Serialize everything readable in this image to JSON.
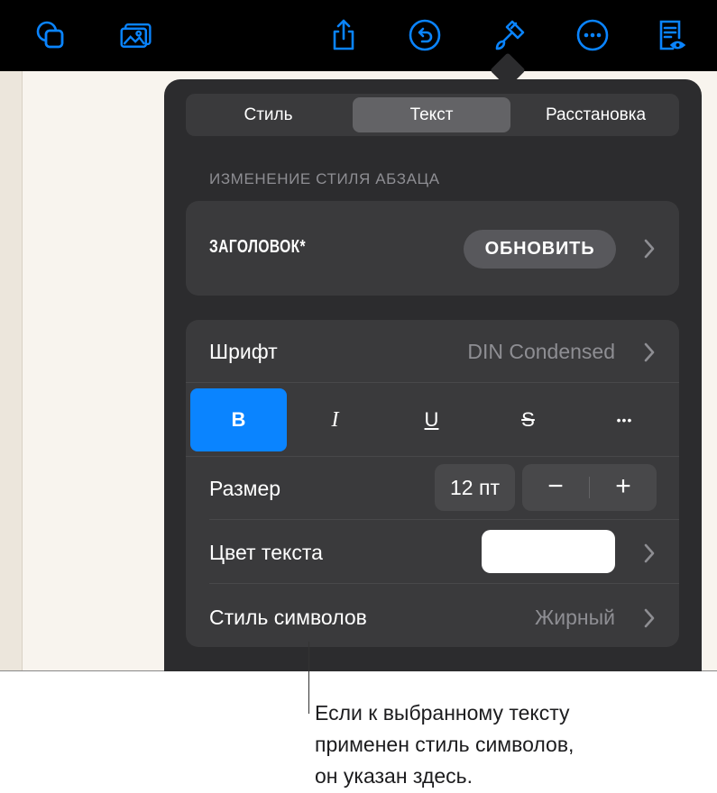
{
  "toolbar": {
    "icons": [
      "shapes-icon",
      "media-icon",
      "share-icon",
      "undo-icon",
      "format-paintbrush-icon",
      "more-icon",
      "reading-view-icon"
    ],
    "accent_color": "#0a84ff"
  },
  "format_panel": {
    "tabs": [
      {
        "label": "Стиль",
        "active": false
      },
      {
        "label": "Текст",
        "active": true
      },
      {
        "label": "Расстановка",
        "active": false
      }
    ],
    "section_label": "ИЗМЕНЕНИЕ СТИЛЯ АБЗАЦА",
    "paragraph_style": {
      "name": "ЗАГОЛОВОК*",
      "update_label": "ОБНОВИТЬ"
    },
    "font": {
      "label": "Шрифт",
      "value": "DIN Condensed"
    },
    "format_buttons": [
      {
        "label": "B",
        "name": "bold",
        "active": true
      },
      {
        "label": "I",
        "name": "italic",
        "active": false
      },
      {
        "label": "U",
        "name": "underline",
        "active": false
      },
      {
        "label": "S",
        "name": "strikethrough",
        "active": false
      },
      {
        "label": "•••",
        "name": "more-text-options",
        "active": false
      }
    ],
    "size": {
      "label": "Размер",
      "value": "12 пт",
      "decrement_label": "−",
      "increment_label": "+"
    },
    "text_color": {
      "label": "Цвет текста",
      "color": "#ffffff"
    },
    "char_style": {
      "label": "Стиль символов",
      "value": "Жирный"
    }
  },
  "callout": {
    "lines": [
      "Если к выбранному тексту",
      "применен стиль символов,",
      "он указан здесь."
    ]
  }
}
